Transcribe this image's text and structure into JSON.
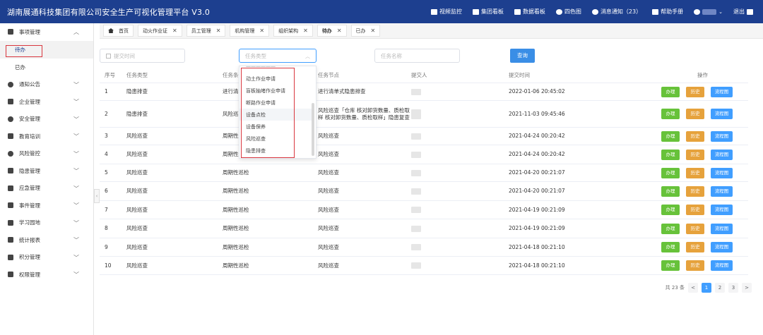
{
  "header": {
    "title": "湖南展通科技集团有限公司安全生产可视化管理平台  V3.0",
    "nav": [
      {
        "label": "视频监控",
        "icon": "video-camera-icon"
      },
      {
        "label": "集团看板",
        "icon": "map-icon"
      },
      {
        "label": "数据看板",
        "icon": "bar-chart-icon"
      },
      {
        "label": "四色图",
        "icon": "cube-icon"
      },
      {
        "label": "消息通知（23）",
        "icon": "bell-icon"
      },
      {
        "label": "帮助手册",
        "icon": "book-icon"
      }
    ],
    "logout": "退出"
  },
  "sidebar": {
    "items": [
      {
        "label": "事项管理",
        "icon": "task-icon",
        "expanded": true
      },
      {
        "label": "通知公告",
        "icon": "bell-icon"
      },
      {
        "label": "企业管理",
        "icon": "building-icon"
      },
      {
        "label": "安全管理",
        "icon": "shield-icon"
      },
      {
        "label": "教育培训",
        "icon": "graduation-cap-icon"
      },
      {
        "label": "风险管控",
        "icon": "radar-icon"
      },
      {
        "label": "隐患管理",
        "icon": "computer-icon"
      },
      {
        "label": "应急管理",
        "icon": "users-icon"
      },
      {
        "label": "事件管理",
        "icon": "document-icon"
      },
      {
        "label": "学习园地",
        "icon": "book-icon"
      },
      {
        "label": "统计报表",
        "icon": "chart-icon"
      },
      {
        "label": "积分管理",
        "icon": "database-icon"
      },
      {
        "label": "权限管理",
        "icon": "lock-icon"
      }
    ],
    "sub_items": [
      "待办",
      "已办"
    ]
  },
  "tabs": [
    {
      "label": "首页"
    },
    {
      "label": "动火作业证"
    },
    {
      "label": "员工管理"
    },
    {
      "label": "机构管理"
    },
    {
      "label": "组织架构"
    },
    {
      "label": "待办"
    },
    {
      "label": "已办"
    }
  ],
  "filters": {
    "submit_time_placeholder": "提交时间",
    "task_type_placeholder": "任务类型",
    "task_name_placeholder": "任务名称",
    "query_label": "查询"
  },
  "table": {
    "headers": [
      "序号",
      "任务类型",
      "任务条件",
      "任务节点",
      "提交人",
      "提交时间",
      "操作"
    ],
    "rows": [
      {
        "idx": "1",
        "type": "隐患排查",
        "cond": "进行清单",
        "node": "进行清单式隐患排查",
        "time": "2022-01-06 20:45:02"
      },
      {
        "idx": "2",
        "type": "隐患排查",
        "cond": "风险巡查 样 核对",
        "node": "风险巡查「仓库 核对卸货数量、质检取样 核对卸货数量、质检取样」隐患复查",
        "time": "2021-11-03 09:45:46"
      },
      {
        "idx": "3",
        "type": "风险巡查",
        "cond": "周期性巡检",
        "node": "风险巡查",
        "time": "2021-04-24 00:20:42"
      },
      {
        "idx": "4",
        "type": "风险巡查",
        "cond": "周期性巡检",
        "node": "风险巡查",
        "time": "2021-04-24 00:20:42"
      },
      {
        "idx": "5",
        "type": "风险巡查",
        "cond": "周期性巡检",
        "node": "风险巡查",
        "time": "2021-04-20 00:21:07"
      },
      {
        "idx": "6",
        "type": "风险巡查",
        "cond": "周期性巡检",
        "node": "风险巡查",
        "time": "2021-04-20 00:21:07"
      },
      {
        "idx": "7",
        "type": "风险巡查",
        "cond": "周期性巡检",
        "node": "风险巡查",
        "time": "2021-04-19 00:21:09"
      },
      {
        "idx": "8",
        "type": "风险巡查",
        "cond": "周期性巡检",
        "node": "风险巡查",
        "time": "2021-04-19 00:21:09"
      },
      {
        "idx": "9",
        "type": "风险巡查",
        "cond": "周期性巡检",
        "node": "风险巡查",
        "time": "2021-04-18 00:21:10"
      },
      {
        "idx": "10",
        "type": "风险巡查",
        "cond": "周期性巡检",
        "node": "风险巡查",
        "time": "2021-04-18 00:21:10"
      }
    ],
    "ops": {
      "handle": "办理",
      "history": "历史",
      "flow": "流程图"
    }
  },
  "dropdown": {
    "options": [
      "动土作业申请",
      "盲板抽堵作业申请",
      "断路作业申请",
      "设备点检",
      "设备保养",
      "风险巡查",
      "隐患排查"
    ],
    "hovered_index": 3
  },
  "pagination": {
    "total": "共 23 条",
    "pages": [
      "1",
      "2",
      "3"
    ],
    "current": "1",
    "prev": "<",
    "next": ">"
  },
  "colors": {
    "header_bg": "#1d3f8f",
    "primary": "#409eff",
    "success": "#67c23a",
    "warning": "#e6a23c",
    "highlight_box": "#d9363e"
  }
}
